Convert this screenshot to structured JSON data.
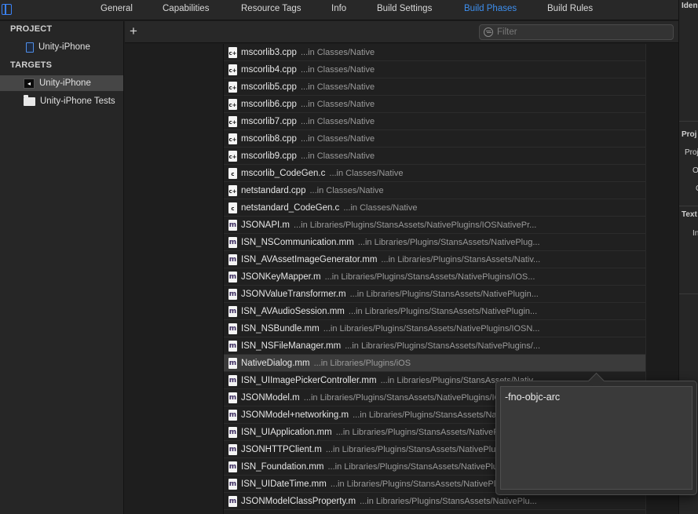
{
  "tabs": [
    {
      "label": "General",
      "active": false
    },
    {
      "label": "Capabilities",
      "active": false
    },
    {
      "label": "Resource Tags",
      "active": false
    },
    {
      "label": "Info",
      "active": false
    },
    {
      "label": "Build Settings",
      "active": false
    },
    {
      "label": "Build Phases",
      "active": true
    },
    {
      "label": "Build Rules",
      "active": false
    }
  ],
  "sidebar": {
    "project_header": "PROJECT",
    "project_item": "Unity-iPhone",
    "targets_header": "TARGETS",
    "targets": [
      {
        "label": "Unity-iPhone",
        "icon": "unity-icon",
        "selected": true
      },
      {
        "label": "Unity-iPhone Tests",
        "icon": "folder-icon",
        "selected": false
      }
    ]
  },
  "toolbar": {
    "add_label": "+",
    "filter_placeholder": "Filter"
  },
  "files": [
    {
      "name": "mscorlib3.cpp",
      "path": "...in Classes/Native",
      "type": "cpp"
    },
    {
      "name": "mscorlib4.cpp",
      "path": "...in Classes/Native",
      "type": "cpp"
    },
    {
      "name": "mscorlib5.cpp",
      "path": "...in Classes/Native",
      "type": "cpp"
    },
    {
      "name": "mscorlib6.cpp",
      "path": "...in Classes/Native",
      "type": "cpp"
    },
    {
      "name": "mscorlib7.cpp",
      "path": "...in Classes/Native",
      "type": "cpp"
    },
    {
      "name": "mscorlib8.cpp",
      "path": "...in Classes/Native",
      "type": "cpp"
    },
    {
      "name": "mscorlib9.cpp",
      "path": "...in Classes/Native",
      "type": "cpp"
    },
    {
      "name": "mscorlib_CodeGen.c",
      "path": "...in Classes/Native",
      "type": "c"
    },
    {
      "name": "netstandard.cpp",
      "path": "...in Classes/Native",
      "type": "cpp"
    },
    {
      "name": "netstandard_CodeGen.c",
      "path": "...in Classes/Native",
      "type": "c"
    },
    {
      "name": "JSONAPI.m",
      "path": "...in Libraries/Plugins/StansAssets/NativePlugins/IOSNativePr...",
      "type": "m"
    },
    {
      "name": "ISN_NSCommunication.mm",
      "path": "...in Libraries/Plugins/StansAssets/NativePlug...",
      "type": "m"
    },
    {
      "name": "ISN_AVAssetImageGenerator.mm",
      "path": "...in Libraries/Plugins/StansAssets/Nativ...",
      "type": "m"
    },
    {
      "name": "JSONKeyMapper.m",
      "path": "...in Libraries/Plugins/StansAssets/NativePlugins/IOS...",
      "type": "m"
    },
    {
      "name": "JSONValueTransformer.m",
      "path": "...in Libraries/Plugins/StansAssets/NativePlugin...",
      "type": "m"
    },
    {
      "name": "ISN_AVAudioSession.mm",
      "path": "...in Libraries/Plugins/StansAssets/NativePlugin...",
      "type": "m"
    },
    {
      "name": "ISN_NSBundle.mm",
      "path": "...in Libraries/Plugins/StansAssets/NativePlugins/IOSN...",
      "type": "m"
    },
    {
      "name": "ISN_NSFileManager.mm",
      "path": "...in Libraries/Plugins/StansAssets/NativePlugins/...",
      "type": "m"
    },
    {
      "name": "NativeDialog.mm",
      "path": "...in Libraries/Plugins/iOS",
      "type": "m",
      "selected": true
    },
    {
      "name": "ISN_UIImagePickerController.mm",
      "path": "...in Libraries/Plugins/StansAssets/Nativ...",
      "type": "m"
    },
    {
      "name": "JSONModel.m",
      "path": "...in Libraries/Plugins/StansAssets/NativePlugins/IOSNativePr...",
      "type": "m"
    },
    {
      "name": "JSONModel+networking.m",
      "path": "...in Libraries/Plugins/StansAssets/NativePlugin...",
      "type": "m"
    },
    {
      "name": "ISN_UIApplication.mm",
      "path": "...in Libraries/Plugins/StansAssets/NativePlugins/...",
      "type": "m"
    },
    {
      "name": "JSONHTTPClient.m",
      "path": "...in Libraries/Plugins/StansAssets/NativePlugins/IOS...",
      "type": "m"
    },
    {
      "name": "ISN_Foundation.mm",
      "path": "...in Libraries/Plugins/StansAssets/NativePlugins/IOS...",
      "type": "m"
    },
    {
      "name": "ISN_UIDateTime.mm",
      "path": "...in Libraries/Plugins/StansAssets/NativePlugins/IO...",
      "type": "m"
    },
    {
      "name": "JSONModelClassProperty.m",
      "path": "...in Libraries/Plugins/StansAssets/NativePlu...",
      "type": "m"
    }
  ],
  "popover": {
    "compiler_flags": "-fno-objc-arc"
  },
  "inspector": {
    "labels": [
      "Iden",
      "Proj",
      "Proj",
      "O",
      "C",
      "Text",
      "In"
    ]
  },
  "colors": {
    "accent": "#3d8fef",
    "background": "#1e1e1e",
    "selected_row": "#3b3b3b"
  }
}
